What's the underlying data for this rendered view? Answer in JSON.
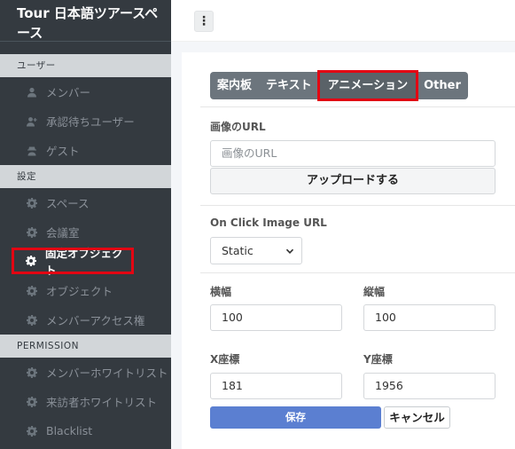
{
  "brand": {
    "title": "Tour 日本語ツアースペース"
  },
  "sidebar": {
    "sections": [
      {
        "title": "ユーザー",
        "items": [
          {
            "label": "メンバー",
            "icon": "user-icon"
          },
          {
            "label": "承認待ちユーザー",
            "icon": "user-plus-icon"
          },
          {
            "label": "ゲスト",
            "icon": "user-secret-icon"
          }
        ]
      },
      {
        "title": "設定",
        "items": [
          {
            "label": "スペース",
            "icon": "gear-icon"
          },
          {
            "label": "会議室",
            "icon": "gear-icon"
          },
          {
            "label": "固定オブジェクト",
            "icon": "gear-icon",
            "active": true
          },
          {
            "label": "オブジェクト",
            "icon": "gear-icon"
          },
          {
            "label": "メンバーアクセス権",
            "icon": "gear-icon"
          }
        ]
      },
      {
        "title": "PERMISSION",
        "items": [
          {
            "label": "メンバーホワイトリスト",
            "icon": "gear-icon"
          },
          {
            "label": "来訪者ホワイトリスト",
            "icon": "gear-icon"
          },
          {
            "label": "Blacklist",
            "icon": "gear-icon"
          }
        ]
      }
    ]
  },
  "topbar": {
    "menu_glyph": "⋮"
  },
  "tabs": [
    {
      "label": "案内板"
    },
    {
      "label": "テキスト"
    },
    {
      "label": "アニメーション",
      "active": true
    },
    {
      "label": "Other"
    }
  ],
  "form": {
    "image_url": {
      "label": "画像のURL",
      "placeholder": "画像のURL",
      "value": ""
    },
    "upload_button": "アップロードする",
    "click_url": {
      "label": "On Click Image URL",
      "selected": "Static"
    },
    "width": {
      "label": "横幅",
      "value": "100"
    },
    "height": {
      "label": "縦幅",
      "value": "100"
    },
    "x": {
      "label": "X座標",
      "value": "181"
    },
    "y": {
      "label": "Y座標",
      "value": "1956"
    },
    "save_button": "保存",
    "cancel_button": "キャンセル"
  },
  "colors": {
    "sidebar_bg": "#343a40",
    "section_bg": "#d2d6d9",
    "tab_bg": "#6c757d",
    "highlight": "#e30613",
    "primary": "#5b7fd1"
  }
}
